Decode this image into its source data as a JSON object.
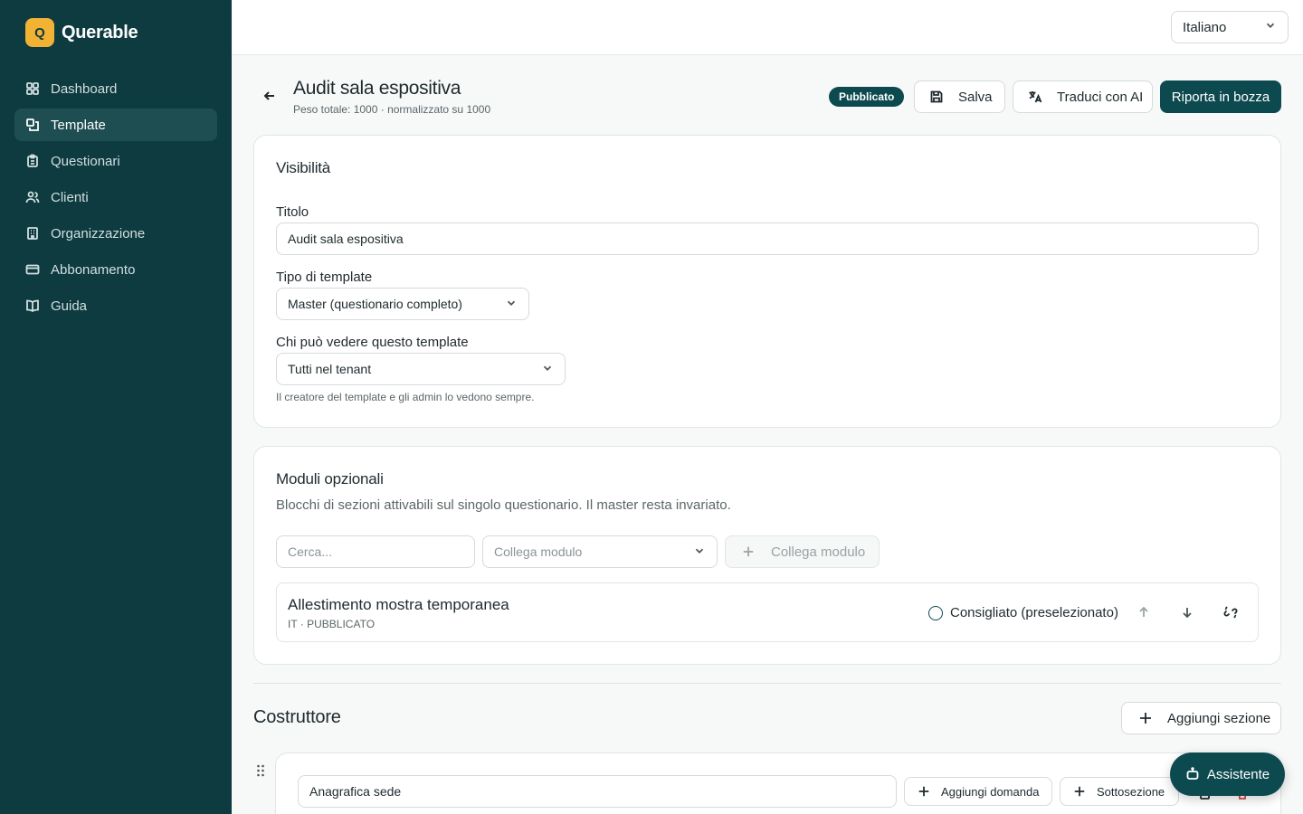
{
  "brand": {
    "logo_letter": "Q",
    "name": "Querable",
    "logo_color": "#f2b233"
  },
  "sidebar": {
    "items": [
      {
        "label": "Dashboard",
        "icon": "dashboard-grid-icon",
        "active": false
      },
      {
        "label": "Template",
        "icon": "template-stack-icon",
        "active": true
      },
      {
        "label": "Questionari",
        "icon": "clipboard-icon",
        "active": false
      },
      {
        "label": "Clienti",
        "icon": "users-icon",
        "active": false
      },
      {
        "label": "Organizzazione",
        "icon": "building-icon",
        "active": false
      },
      {
        "label": "Abbonamento",
        "icon": "credit-card-icon",
        "active": false
      },
      {
        "label": "Guida",
        "icon": "book-icon",
        "active": false
      }
    ]
  },
  "topbar": {
    "language": "Italiano"
  },
  "header": {
    "title": "Audit sala espositiva",
    "subtitle": "Peso totale: 1000 · normalizzato su 1000",
    "status": "Pubblicato",
    "save_label": "Salva",
    "translate_label": "Traduci con AI",
    "revert_label": "Riporta in bozza"
  },
  "visibility": {
    "title": "Visibilità",
    "title_label": "Titolo",
    "title_value": "Audit sala espositiva",
    "type_label": "Tipo di template",
    "type_value": "Master (questionario completo)",
    "audience_label": "Chi può vedere questo template",
    "audience_value": "Tutti nel tenant",
    "help": "Il creatore del template e gli admin lo vedono sempre."
  },
  "modules": {
    "title": "Moduli opzionali",
    "description": "Blocchi di sezioni attivabili sul singolo questionario. Il master resta invariato.",
    "search_placeholder": "Cerca...",
    "link_select_placeholder": "Collega modulo",
    "link_button": "Collega modulo",
    "items": [
      {
        "name": "Allestimento mostra temporanea",
        "meta": "IT · PUBBLICATO",
        "recommended_label": "Consigliato (preselezionato)",
        "recommended": false
      }
    ]
  },
  "builder": {
    "title": "Costruttore",
    "add_section_label": "Aggiungi sezione",
    "sections": [
      {
        "name": "Anagrafica sede",
        "add_question_label": "Aggiungi domanda",
        "subsection_label": "Sottosezione"
      }
    ]
  },
  "assistant": {
    "label": "Assistente"
  },
  "colors": {
    "sidebar_bg": "#0d3b40",
    "primary": "#0d4a4f",
    "danger": "#d64545"
  }
}
